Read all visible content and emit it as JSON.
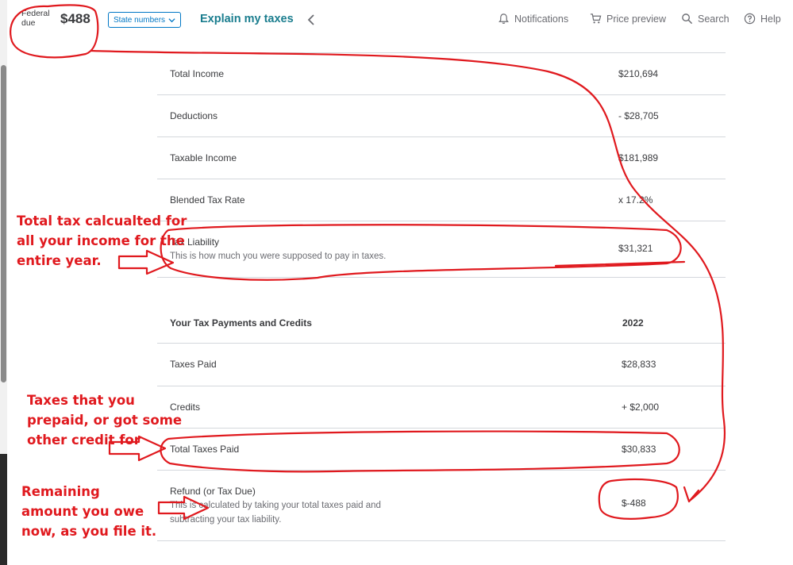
{
  "header": {
    "federal_label": "Federal due",
    "federal_amount": "$488",
    "state_button": "State numbers",
    "explain_link": "Explain my taxes",
    "nav": {
      "notifications": "Notifications",
      "price_preview": "Price preview",
      "search": "Search",
      "help": "Help"
    }
  },
  "summary_rows": [
    {
      "label": "Total Income",
      "value": "$210,694"
    },
    {
      "label": "Deductions",
      "value": "- $28,705"
    },
    {
      "label": "Taxable Income",
      "value": "$181,989"
    },
    {
      "label": "Blended Tax Rate",
      "value": "x 17.2%"
    },
    {
      "label": "Tax Liability",
      "sub": "This is how much you were supposed to pay in taxes.",
      "value": "$31,321"
    }
  ],
  "payments_header": {
    "label": "Your Tax Payments and Credits",
    "value": "2022"
  },
  "payment_rows": [
    {
      "label": "Taxes Paid",
      "value": "$28,833"
    },
    {
      "label": "Credits",
      "value": "+ $2,000"
    },
    {
      "label": "Total Taxes Paid",
      "value": "$30,833"
    },
    {
      "label": "Refund (or Tax Due)",
      "sub": "This is calculated by taking your total taxes paid and subtracting your tax liability.",
      "value": "$-488"
    }
  ],
  "annotations": {
    "tax_liability_note": "Total tax calcualted for all your income for the entire year.",
    "prepaid_note": "Taxes that you prepaid, or got some other credit for",
    "remaining_note": "Remaining amount you owe now, as you file it."
  },
  "colors": {
    "accent": "#0077c5",
    "link": "#1a7d8e",
    "annotation": "#e0191e"
  }
}
